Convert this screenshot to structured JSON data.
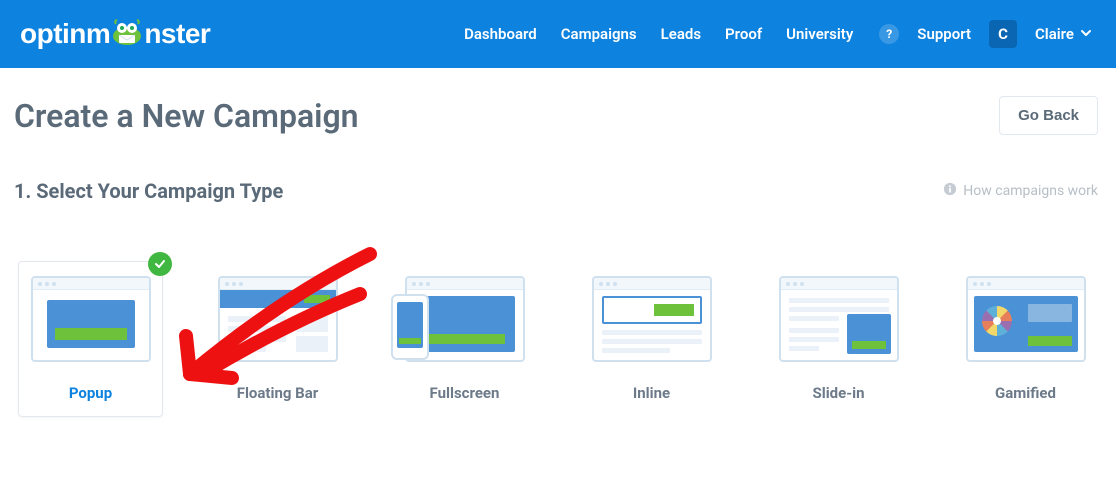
{
  "brand": {
    "name_a": "optinm",
    "name_b": "nster"
  },
  "nav": {
    "links": [
      "Dashboard",
      "Campaigns",
      "Leads",
      "Proof",
      "University"
    ],
    "support": "Support",
    "user_initial": "C",
    "user_name": "Claire"
  },
  "page": {
    "title": "Create a New Campaign",
    "go_back": "Go Back"
  },
  "section": {
    "title": "1. Select Your Campaign Type",
    "help": "How campaigns work"
  },
  "types": [
    {
      "label": "Popup",
      "selected": true
    },
    {
      "label": "Floating Bar",
      "selected": false
    },
    {
      "label": "Fullscreen",
      "selected": false
    },
    {
      "label": "Inline",
      "selected": false
    },
    {
      "label": "Slide-in",
      "selected": false
    },
    {
      "label": "Gamified",
      "selected": false
    }
  ]
}
